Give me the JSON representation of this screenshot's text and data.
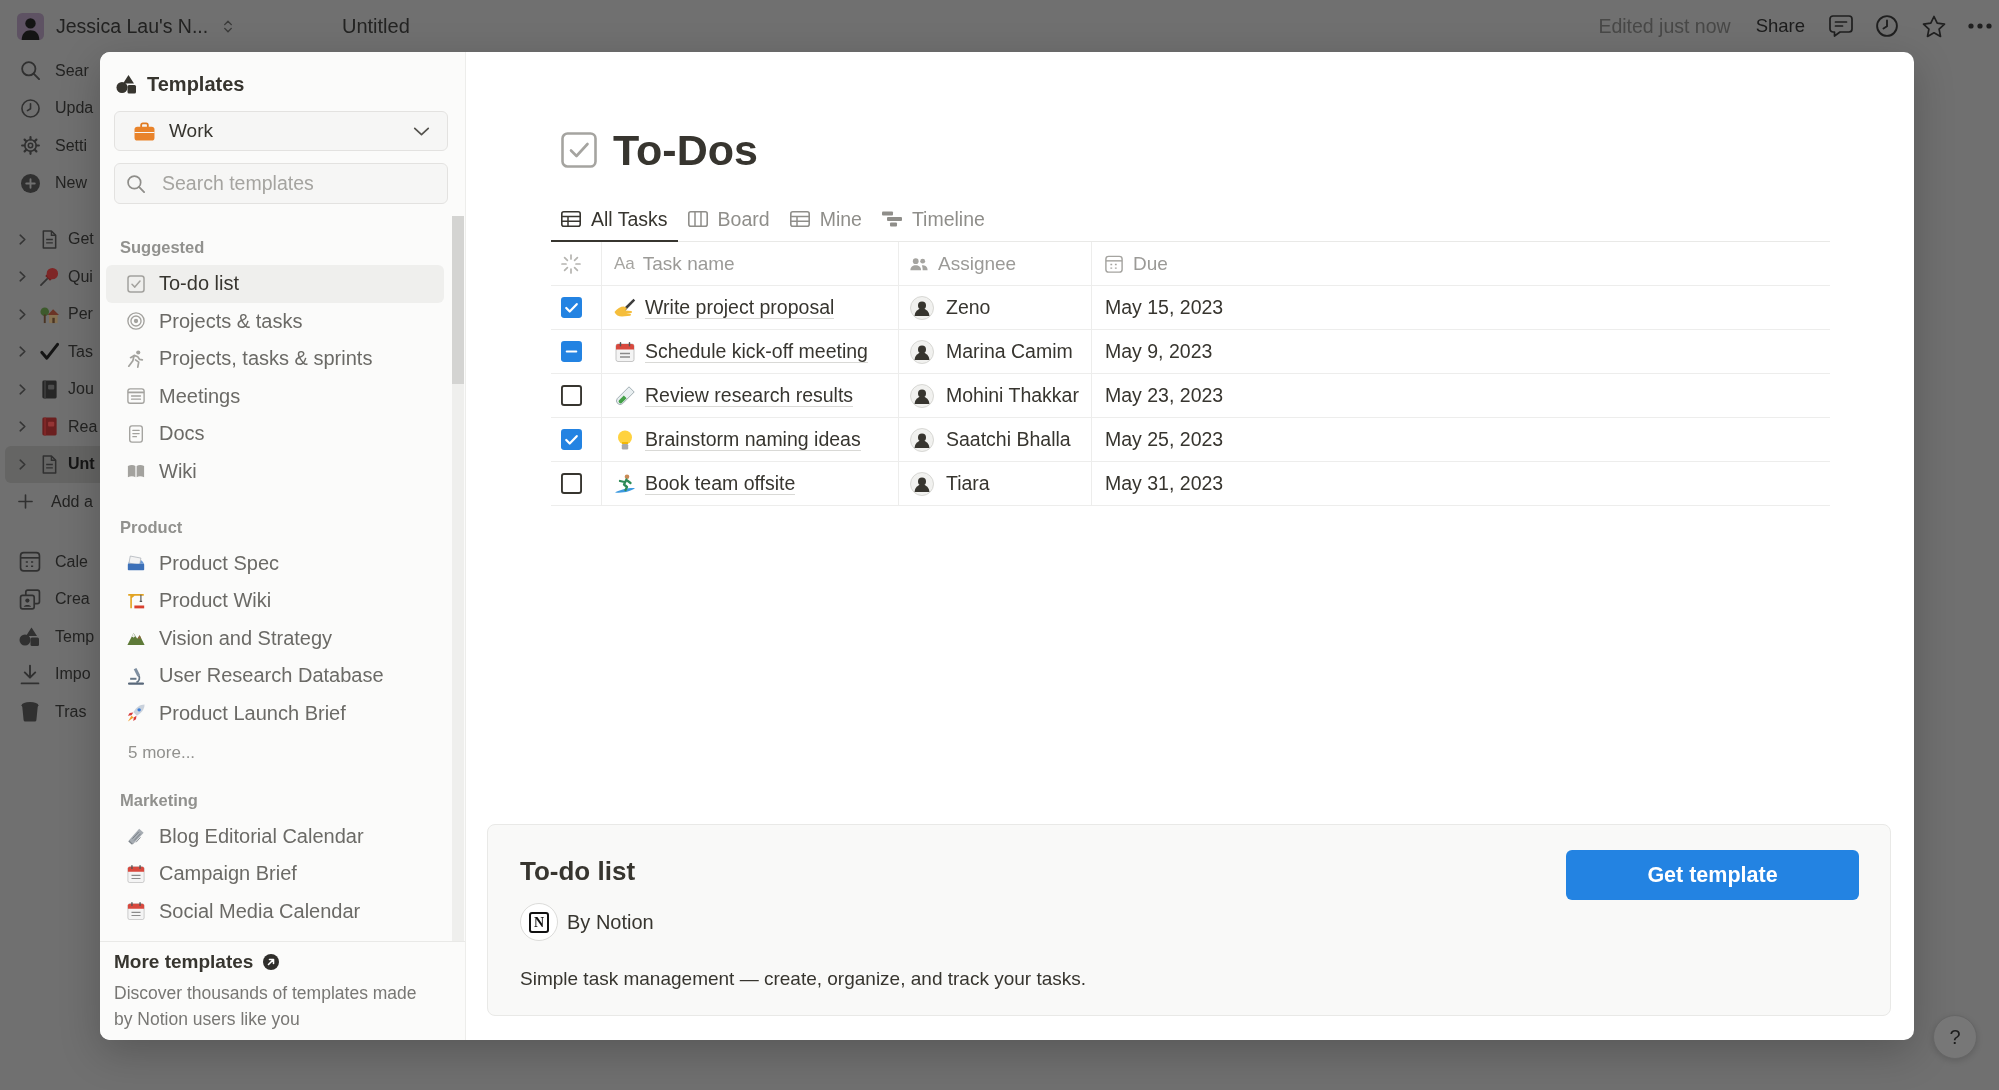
{
  "workspace": {
    "name": "Jessica Lau's N..."
  },
  "topbar": {
    "page_title": "Untitled",
    "status": "Edited just now",
    "share": "Share"
  },
  "sidebar": {
    "nav": [
      "Sear",
      "Upda",
      "Setti",
      "New"
    ],
    "pages": [
      {
        "label": "Get",
        "selected": false
      },
      {
        "label": "Qui",
        "selected": false
      },
      {
        "label": "Per",
        "selected": false
      },
      {
        "label": "Tas",
        "selected": false
      },
      {
        "label": "Jou",
        "selected": false
      },
      {
        "label": "Rea",
        "selected": false
      },
      {
        "label": "Unt",
        "selected": true
      }
    ],
    "add_page": "Add a",
    "tools": [
      "Cale",
      "Crea",
      "Temp",
      "Impo",
      "Tras"
    ]
  },
  "templates": {
    "title": "Templates",
    "category": "Work",
    "search": {
      "placeholder": "Search templates"
    },
    "sections": [
      {
        "heading": "Suggested",
        "items": [
          {
            "label": "To-do list",
            "selected": true
          },
          {
            "label": "Projects & tasks",
            "selected": false
          },
          {
            "label": "Projects, tasks & sprints",
            "selected": false
          },
          {
            "label": "Meetings",
            "selected": false
          },
          {
            "label": "Docs",
            "selected": false
          },
          {
            "label": "Wiki",
            "selected": false
          }
        ]
      },
      {
        "heading": "Product",
        "items": [
          {
            "label": "Product Spec",
            "selected": false
          },
          {
            "label": "Product Wiki",
            "selected": false
          },
          {
            "label": "Vision and Strategy",
            "selected": false
          },
          {
            "label": "User Research Database",
            "selected": false
          },
          {
            "label": "Product Launch Brief",
            "selected": false
          }
        ],
        "more": "5 more..."
      },
      {
        "heading": "Marketing",
        "items": [
          {
            "label": "Blog Editorial Calendar",
            "selected": false
          },
          {
            "label": "Campaign Brief",
            "selected": false
          },
          {
            "label": "Social Media Calendar",
            "selected": false
          }
        ]
      }
    ],
    "footer": {
      "title": "More templates",
      "text": "Discover thousands of templates made by Notion users like you"
    }
  },
  "preview": {
    "title": "To-Dos",
    "views": [
      {
        "kind": "table",
        "label": "All Tasks",
        "selected": true
      },
      {
        "kind": "board",
        "label": "Board",
        "selected": false
      },
      {
        "kind": "table",
        "label": "Mine",
        "selected": false
      },
      {
        "kind": "timeline",
        "label": "Timeline",
        "selected": false
      }
    ],
    "columns": [
      {
        "kind": "title",
        "glyph": "Aa",
        "label": "Task name"
      },
      {
        "kind": "person",
        "label": "Assignee"
      },
      {
        "kind": "date",
        "label": "Due"
      }
    ],
    "rows": [
      {
        "checked": true,
        "indeterminate": false,
        "task": "Write project proposal",
        "assignee": "Zeno",
        "due": "May 15, 2023"
      },
      {
        "checked": true,
        "indeterminate": true,
        "task": "Schedule kick-off meeting",
        "assignee": "Marina Camim",
        "due": "May 9, 2023"
      },
      {
        "checked": false,
        "indeterminate": false,
        "task": "Review research results",
        "assignee": "Mohini Thakkar",
        "due": "May 23, 2023"
      },
      {
        "checked": true,
        "indeterminate": false,
        "task": "Brainstorm naming ideas",
        "assignee": "Saatchi Bhalla",
        "due": "May 25, 2023"
      },
      {
        "checked": false,
        "indeterminate": false,
        "task": "Book team offsite",
        "assignee": "Tiara",
        "due": "May 31, 2023"
      }
    ]
  },
  "details": {
    "title": "To-do list",
    "logo": "N",
    "author": "By Notion",
    "description": "Simple task management — create, organize, and track your tasks.",
    "button": "Get template"
  },
  "help": {
    "label": "?"
  }
}
